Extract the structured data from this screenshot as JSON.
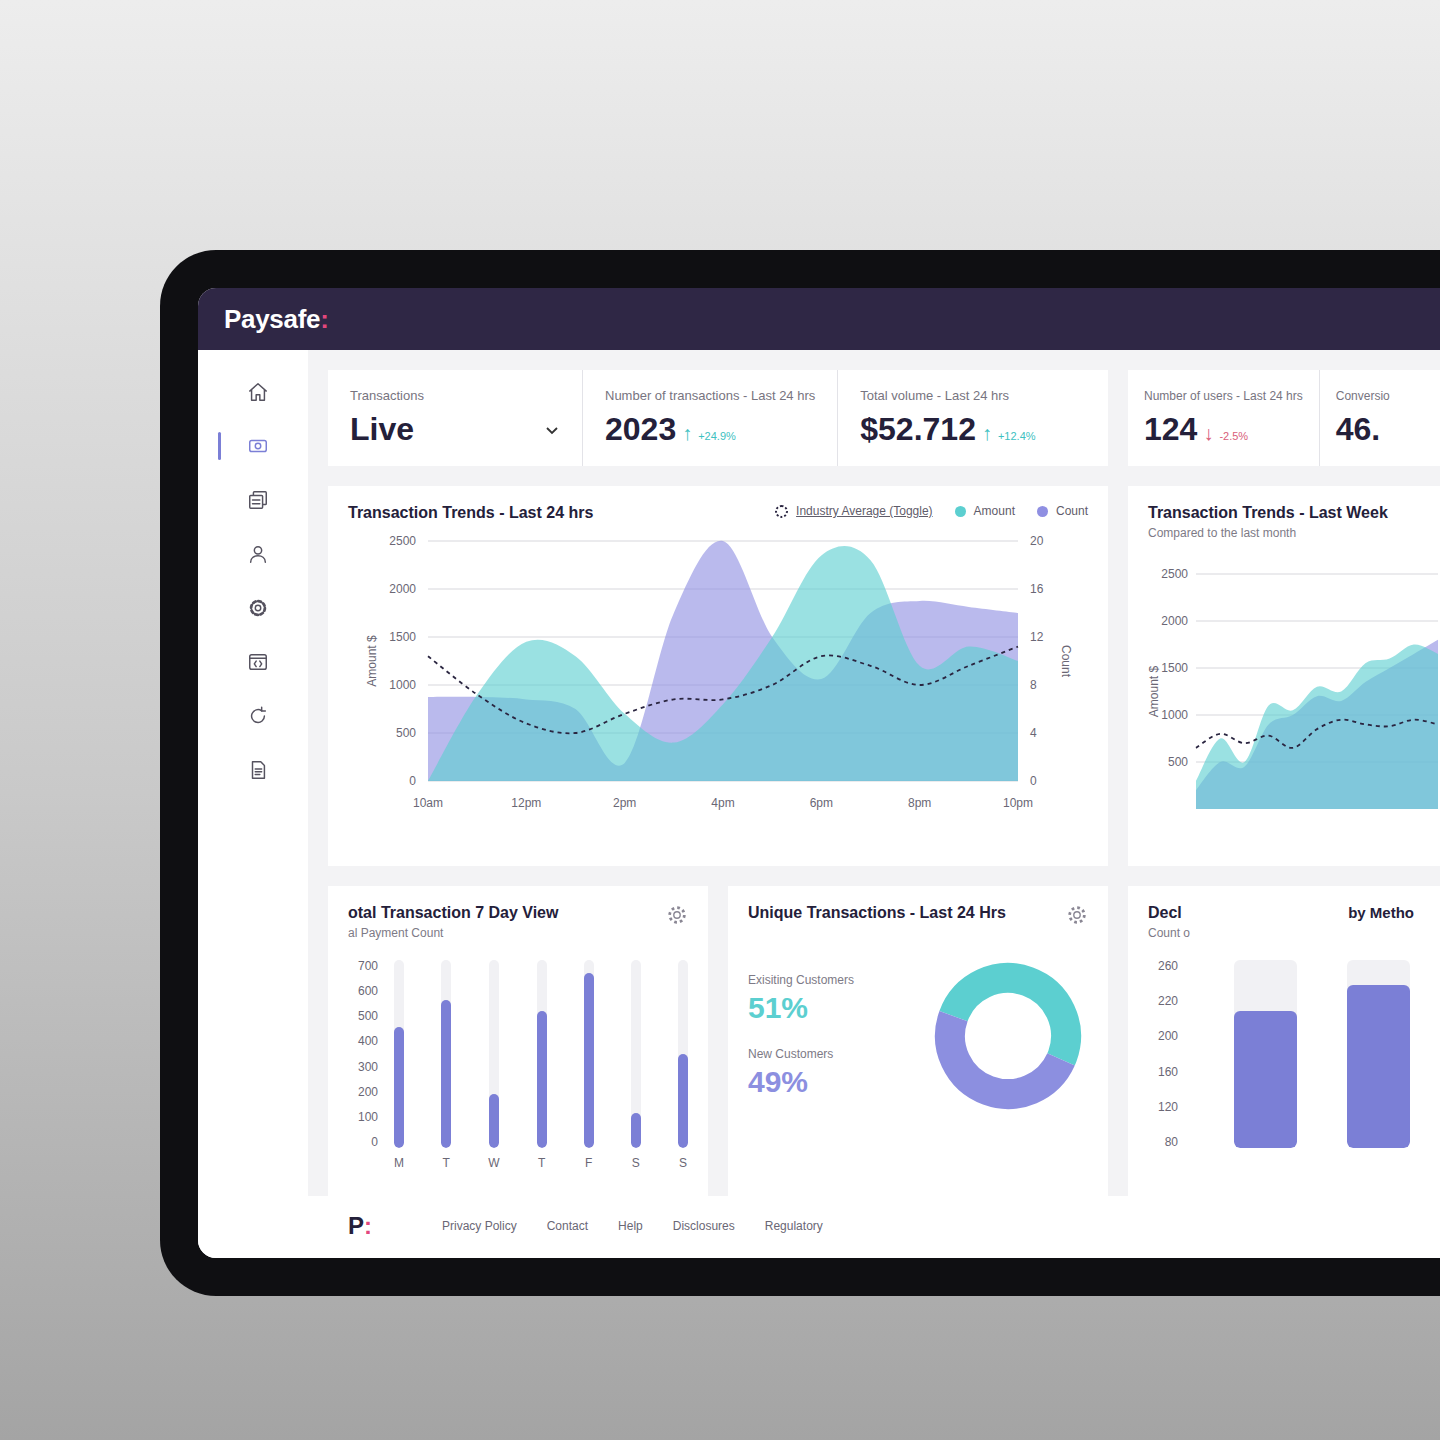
{
  "brand": {
    "name": "Paysafe",
    "mark": ":"
  },
  "sidebar": {
    "items": [
      {
        "kind": "home",
        "selected": false
      },
      {
        "kind": "card",
        "selected": true
      },
      {
        "kind": "docs",
        "selected": false
      },
      {
        "kind": "user",
        "selected": false
      },
      {
        "kind": "gear",
        "selected": false
      },
      {
        "kind": "code",
        "selected": false
      },
      {
        "kind": "refresh",
        "selected": false
      },
      {
        "kind": "file",
        "selected": false
      }
    ]
  },
  "stats": [
    {
      "kind": "select",
      "label": "Transactions",
      "value": "Live"
    },
    {
      "kind": "metric",
      "label": "Number of transactions - Last 24 hrs",
      "value": "2023",
      "arrow": "↑",
      "change": "+24.9%",
      "trend": "up"
    },
    {
      "kind": "metric",
      "label": "Total volume - Last 24 hrs",
      "value": "$52.712",
      "arrow": "↑",
      "change": "+12.4%",
      "trend": "up"
    }
  ],
  "side_stats": [
    {
      "kind": "metric",
      "label": "Number of users - Last 24 hrs",
      "value": "124",
      "arrow": "↓",
      "change": "-2.5%",
      "trend": "down"
    },
    {
      "kind": "plain",
      "label": "Conversio",
      "value": "46."
    }
  ],
  "trends24": {
    "title": "Transaction Trends - Last 24 hrs",
    "left_ticks": [
      "0",
      "500",
      "1000",
      "1500",
      "2000",
      "2500"
    ],
    "left_label": "Amount $",
    "right_ticks": [
      "0",
      "4",
      "8",
      "12",
      "16",
      "20"
    ],
    "right_label": "Count",
    "x_ticks": [
      "10am",
      "12pm",
      "2pm",
      "4pm",
      "6pm",
      "8pm",
      "10pm"
    ],
    "series": [
      {
        "name": "Count",
        "kind": "area",
        "axis": "right",
        "color": "#8f8fe2",
        "values": [
          7,
          7,
          6.8,
          6,
          1.5,
          14,
          20,
          12,
          8.5,
          14,
          15,
          14.5,
          14
        ]
      },
      {
        "name": "Amount",
        "kind": "area",
        "axis": "left",
        "color": "#5ccfd0",
        "values": [
          0,
          900,
          1450,
          1300,
          700,
          400,
          800,
          1500,
          2350,
          2300,
          1200,
          1400,
          1250
        ]
      },
      {
        "name": "Industry Average (Toggle)",
        "kind": "line",
        "axis": "left",
        "color": "#2a2540",
        "values": [
          1300,
          900,
          600,
          500,
          700,
          850,
          850,
          1000,
          1300,
          1200,
          1000,
          1200,
          1400
        ]
      }
    ]
  },
  "trends_week": {
    "title": "Transaction Trends - Last Week",
    "subtitle": "Compared to the last month",
    "ticks": [
      "500",
      "1000",
      "1500",
      "2000",
      "2500"
    ],
    "axis_label": "Amount $",
    "series": [
      {
        "name": "Count",
        "kind": "area",
        "color": "#8f8fe2",
        "values": [
          200,
          500,
          450,
          900,
          1000,
          1200,
          1150,
          1350,
          1500,
          1650,
          1800
        ]
      },
      {
        "name": "Amount",
        "kind": "area",
        "color": "#5ccfd0",
        "values": [
          300,
          750,
          500,
          1100,
          1050,
          1300,
          1250,
          1550,
          1600,
          1750,
          1650
        ]
      },
      {
        "name": "Industry Average",
        "kind": "line",
        "color": "#2a2540",
        "values": [
          650,
          800,
          700,
          780,
          650,
          850,
          950,
          900,
          880,
          950,
          900
        ]
      }
    ]
  },
  "seven_day": {
    "title": "otal Transaction 7 Day View",
    "subtitle": "al Payment Count",
    "ticks": [
      "700",
      "600",
      "500",
      "400",
      "300",
      "200",
      "100",
      "0"
    ],
    "bars": [
      {
        "day": "M",
        "value": 450
      },
      {
        "day": "T",
        "value": 550
      },
      {
        "day": "W",
        "value": 200
      },
      {
        "day": "T",
        "value": 510
      },
      {
        "day": "F",
        "value": 650
      },
      {
        "day": "S",
        "value": 130
      },
      {
        "day": "S",
        "value": 350
      }
    ]
  },
  "unique": {
    "title": "Unique Transactions - Last 24 Hrs",
    "segments": [
      {
        "label": "Exisiting Customers",
        "value": "51%",
        "share": 0.51,
        "color": "#5ccfd0"
      },
      {
        "label": "New Customers",
        "value": "49%",
        "share": 0.49,
        "color": "#8c8fe0"
      }
    ]
  },
  "declines": {
    "title": "Decl",
    "subtitle": "Count o",
    "title_right": "by Metho",
    "ticks": [
      "260",
      "220",
      "200",
      "160",
      "120",
      "80"
    ],
    "bars": [
      190,
      225
    ]
  },
  "footer": {
    "logo": {
      "letter": "P",
      "mark": ":"
    },
    "links": [
      "Privacy Policy",
      "Contact",
      "Help",
      "Disclosures",
      "Regulatory"
    ]
  }
}
